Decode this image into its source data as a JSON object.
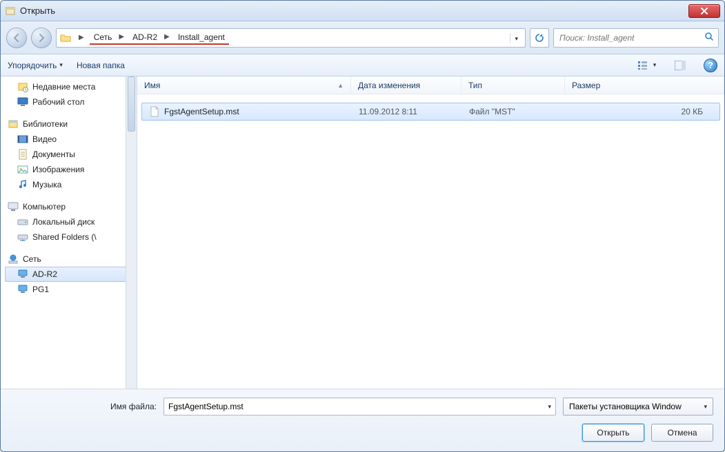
{
  "window": {
    "title": "Открыть"
  },
  "nav": {
    "crumbs": [
      "Сеть",
      "AD-R2",
      "Install_agent"
    ],
    "search_placeholder": "Поиск: Install_agent"
  },
  "toolbar": {
    "organize": "Упорядочить",
    "newfolder": "Новая папка"
  },
  "sidebar": {
    "top_items": [
      {
        "label": "Недавние места",
        "icon": "recent"
      },
      {
        "label": "Рабочий стол",
        "icon": "desktop"
      }
    ],
    "libraries_label": "Библиотеки",
    "libraries": [
      {
        "label": "Видео",
        "icon": "video"
      },
      {
        "label": "Документы",
        "icon": "doc"
      },
      {
        "label": "Изображения",
        "icon": "image"
      },
      {
        "label": "Музыка",
        "icon": "music"
      }
    ],
    "computer_label": "Компьютер",
    "computer_items": [
      {
        "label": "Локальный диск",
        "icon": "hdd"
      },
      {
        "label": "Shared Folders (\\",
        "icon": "netdrive"
      }
    ],
    "network_label": "Сеть",
    "network_items": [
      {
        "label": "AD-R2",
        "icon": "pc",
        "selected": true
      },
      {
        "label": "PG1",
        "icon": "pc"
      }
    ]
  },
  "columns": {
    "name": "Имя",
    "date": "Дата изменения",
    "type": "Тип",
    "size": "Размер"
  },
  "files": [
    {
      "name": "FgstAgentSetup.mst",
      "date": "11.09.2012 8:11",
      "type": "Файл \"MST\"",
      "size": "20 КБ",
      "selected": true
    }
  ],
  "bottom": {
    "filename_label": "Имя файла:",
    "filename_value": "FgstAgentSetup.mst",
    "filter_label": "Пакеты установщика Window",
    "open": "Открыть",
    "cancel": "Отмена"
  },
  "colors": {
    "accent": "#2a7ec9",
    "underline": "#c0392b"
  }
}
